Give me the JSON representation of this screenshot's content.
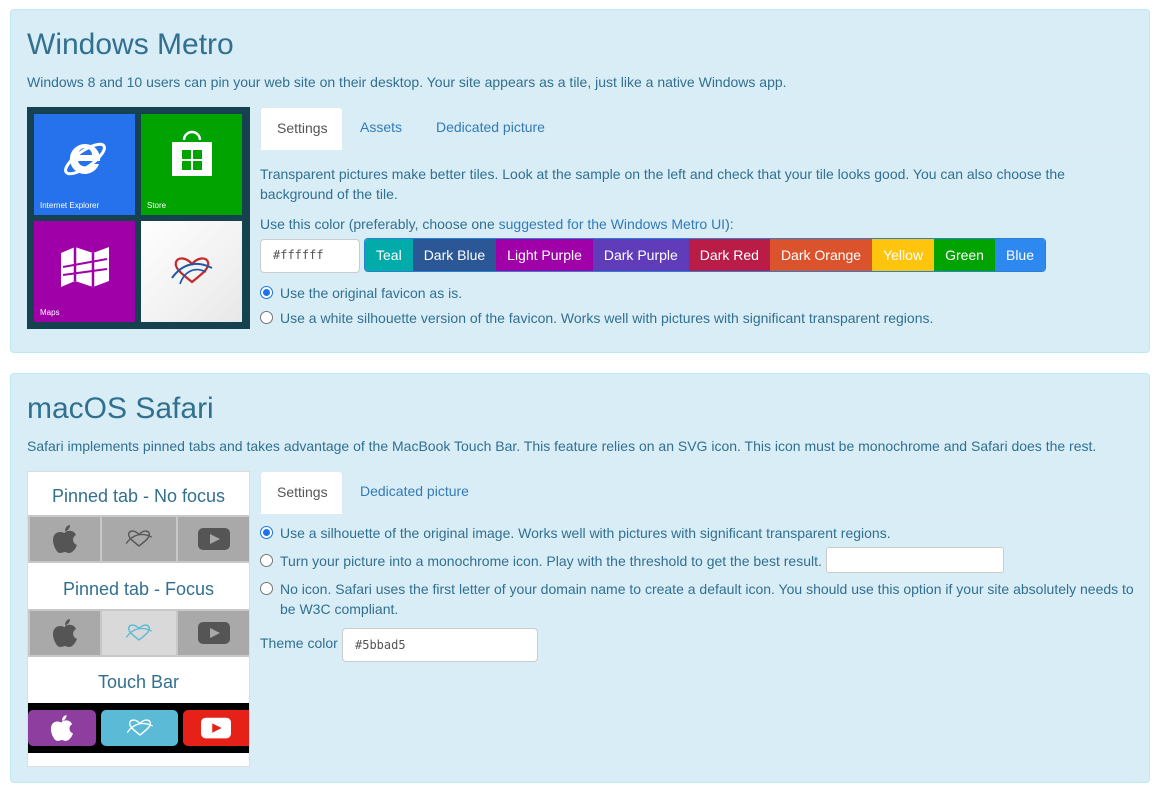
{
  "metro": {
    "title": "Windows Metro",
    "description": "Windows 8 and 10 users can pin your web site on their desktop. Your site appears as a tile, just like a native Windows app.",
    "tiles": {
      "ie": "Internet Explorer",
      "store": "Store",
      "maps": "Maps"
    },
    "tabs": [
      "Settings",
      "Assets",
      "Dedicated picture"
    ],
    "info": "Transparent pictures make better tiles. Look at the sample on the left and check that your tile looks good. You can also choose the",
    "info2": "background of the tile.",
    "color_prompt_prefix": "Use this color (preferably, choose one ",
    "color_prompt_link": "suggested for the Windows Metro UI",
    "color_prompt_suffix": "):",
    "color_value": "#ffffff",
    "swatches": [
      {
        "label": "Teal",
        "color": "#00aba9"
      },
      {
        "label": "Dark Blue",
        "color": "#2b5797"
      },
      {
        "label": "Light Purple",
        "color": "#9f00a7"
      },
      {
        "label": "Dark Purple",
        "color": "#603cba"
      },
      {
        "label": "Dark Red",
        "color": "#b91d47"
      },
      {
        "label": "Dark Orange",
        "color": "#da532c"
      },
      {
        "label": "Yellow",
        "color": "#ffc40d"
      },
      {
        "label": "Green",
        "color": "#00a300"
      },
      {
        "label": "Blue",
        "color": "#2d89ef"
      }
    ],
    "radio_original": "Use the original favicon as is.",
    "radio_silhouette": "Use a white silhouette version of the favicon. Works well with pictures with significant transparent regions."
  },
  "safari": {
    "title": "macOS Safari",
    "description": "Safari implements pinned tabs and takes advantage of the MacBook Touch Bar. This feature relies on an SVG icon. This icon must be monochrome and Safari does the rest.",
    "preview": {
      "no_focus": "Pinned tab - No focus",
      "focus": "Pinned tab - Focus",
      "touch_bar": "Touch Bar"
    },
    "tabs": [
      "Settings",
      "Dedicated picture"
    ],
    "radio_silhouette": "Use a silhouette of the original image. Works well with pictures with significant transparent regions.",
    "radio_monochrome": "Turn your picture into a monochrome icon. Play with the threshold to get the best result.",
    "radio_noicon_1": "No icon. Safari uses the first letter of your domain name to create a default icon. You should use this option if your site absolutely needs to",
    "radio_noicon_2": "be W3C compliant.",
    "theme_label": "Theme color",
    "theme_value": "#5bbad5"
  },
  "colors": {
    "panel_bg": "#d9edf7",
    "text": "#31708f",
    "link": "#337ab7",
    "ie_tile": "#2672ec",
    "store_tile": "#00a300",
    "maps_tile": "#9f00a7",
    "touchbar_purple": "#8e3e9e",
    "touchbar_blue": "#5bbad5",
    "touchbar_red": "#e62117"
  },
  "icons": [
    "internet-explorer-icon",
    "store-icon",
    "maps-icon",
    "heart-logo-icon",
    "apple-icon",
    "youtube-icon"
  ]
}
